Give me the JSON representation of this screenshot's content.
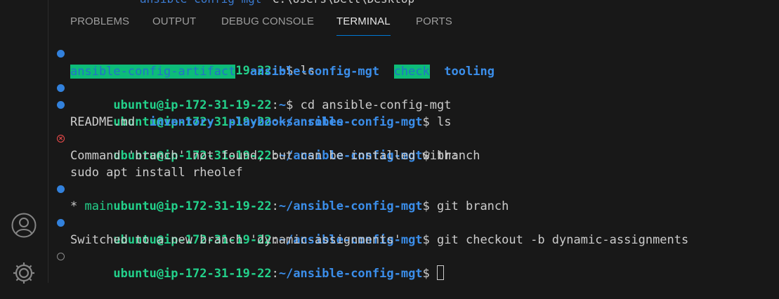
{
  "top_fragment": {
    "path_text": "ansible-config-mgt",
    "path_rest": "   C:\\Users\\Dell\\Desktop"
  },
  "tabs": [
    "PROBLEMS",
    "OUTPUT",
    "DEBUG CONSOLE",
    "TERMINAL",
    "PORTS"
  ],
  "active_tab": "TERMINAL",
  "prompt": {
    "user": "ubuntu@ip-172-31-19-22",
    "home": "~",
    "repo": "~/ansible-config-mgt",
    "sep": ":",
    "dollar": "$ "
  },
  "lines": {
    "cmd1": "ls",
    "ls1": [
      "ansible-config-artifact",
      "ansible-config-mgt",
      "check",
      "tooling"
    ],
    "cmd2": "cd ansible-config-mgt",
    "cmd3": "ls",
    "ls2": [
      "README.md",
      "inventory",
      "playbooks",
      "roles"
    ],
    "cmd4": "branch",
    "out4a": "Command 'branch' not found, but can be installed with:",
    "out4b": "sudo apt install rheolef",
    "cmd5": "git branch",
    "out5_star": "* ",
    "out5_branch": "main",
    "cmd6": "git checkout -b dynamic-assignments",
    "out6": "Switched to a new branch 'dynamic-assignments'"
  },
  "icons": {
    "account": "account-icon",
    "settings": "gear-icon"
  },
  "colors": {
    "prompt_user": "#23d18b",
    "prompt_path": "#3b8eea",
    "error": "#f14c4c",
    "active_tab_border": "#0078d4"
  }
}
